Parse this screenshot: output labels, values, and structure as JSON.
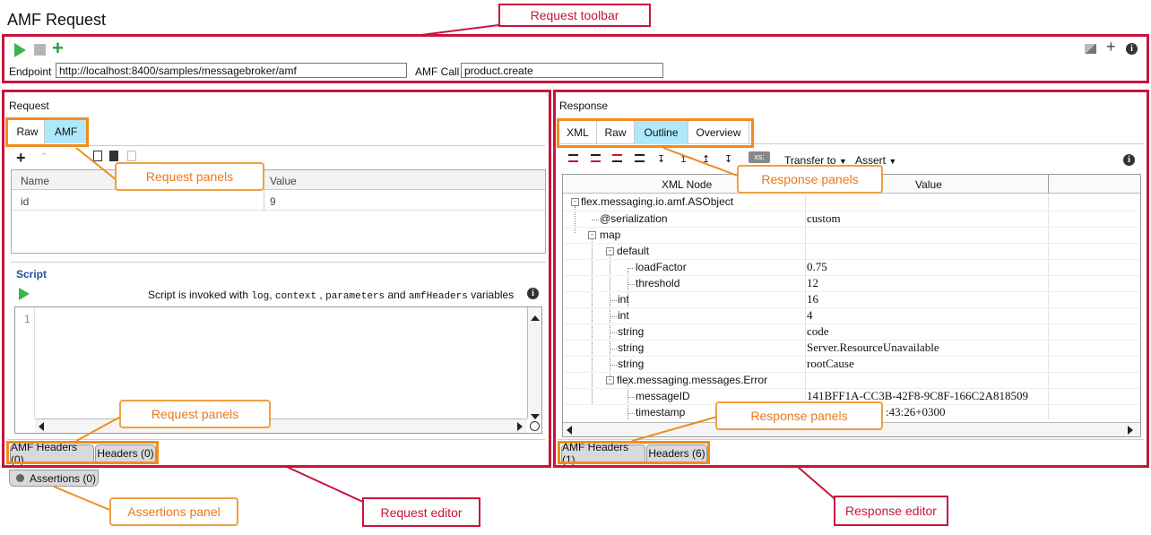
{
  "page_title": "AMF Request",
  "toolbar": {
    "endpoint_label": "Endpoint",
    "endpoint_value": "http://localhost:8400/samples/messagebroker/amf",
    "amf_call_label": "AMF Call",
    "amf_call_value": "product.create"
  },
  "request": {
    "title": "Request",
    "tabs": [
      "Raw",
      "AMF"
    ],
    "table_headers": [
      "Name",
      "Value"
    ],
    "rows": [
      {
        "name": "id",
        "value": "9"
      }
    ],
    "script_label": "Script",
    "script_hint_pre": "Script is invoked with",
    "script_var1": "log",
    "script_var2": "context",
    "script_var3": "parameters",
    "script_and": "and",
    "script_var4": "amfHeaders",
    "script_post": "variables",
    "line_number": "1",
    "bottom_tabs": [
      "AMF Headers (0)",
      "Headers (0)"
    ],
    "assertions": "Assertions (0)"
  },
  "response": {
    "title": "Response",
    "tabs": [
      "XML",
      "Raw",
      "Outline",
      "Overview"
    ],
    "transfer_to": "Transfer to",
    "assert": "Assert",
    "xs_badge": "xs:",
    "table_headers": [
      "XML Node",
      "Value"
    ],
    "tree": [
      {
        "node": "flex.messaging.io.amf.ASObject",
        "value": ""
      },
      {
        "node": "@serialization",
        "value": "custom"
      },
      {
        "node": "map",
        "value": ""
      },
      {
        "node": "default",
        "value": ""
      },
      {
        "node": "loadFactor",
        "value": "0.75"
      },
      {
        "node": "threshold",
        "value": "12"
      },
      {
        "node": "int",
        "value": "16"
      },
      {
        "node": "int",
        "value": "4"
      },
      {
        "node": "string",
        "value": "code"
      },
      {
        "node": "string",
        "value": "Server.ResourceUnavailable"
      },
      {
        "node": "string",
        "value": "rootCause"
      },
      {
        "node": "flex.messaging.messages.Error",
        "value": ""
      },
      {
        "node": "messageID",
        "value": "141BFF1A-CC3B-42F8-9C8F-166C2A818509"
      },
      {
        "node": "timestamp",
        "value": ":43:26+0300"
      }
    ],
    "bottom_tabs": [
      "AMF Headers (1)",
      "Headers (6)"
    ]
  },
  "callouts": {
    "request_toolbar": "Request toolbar",
    "request_panels": "Request panels",
    "response_panels": "Response panels",
    "assertions_panel": "Assertions panel",
    "request_editor": "Request editor",
    "response_editor": "Response editor"
  },
  "colors": {
    "callout_red": "#c8143c",
    "callout_orange": "#f08c1e",
    "tab_selected": "#aee8fb",
    "run_green": "#3cb44b"
  }
}
